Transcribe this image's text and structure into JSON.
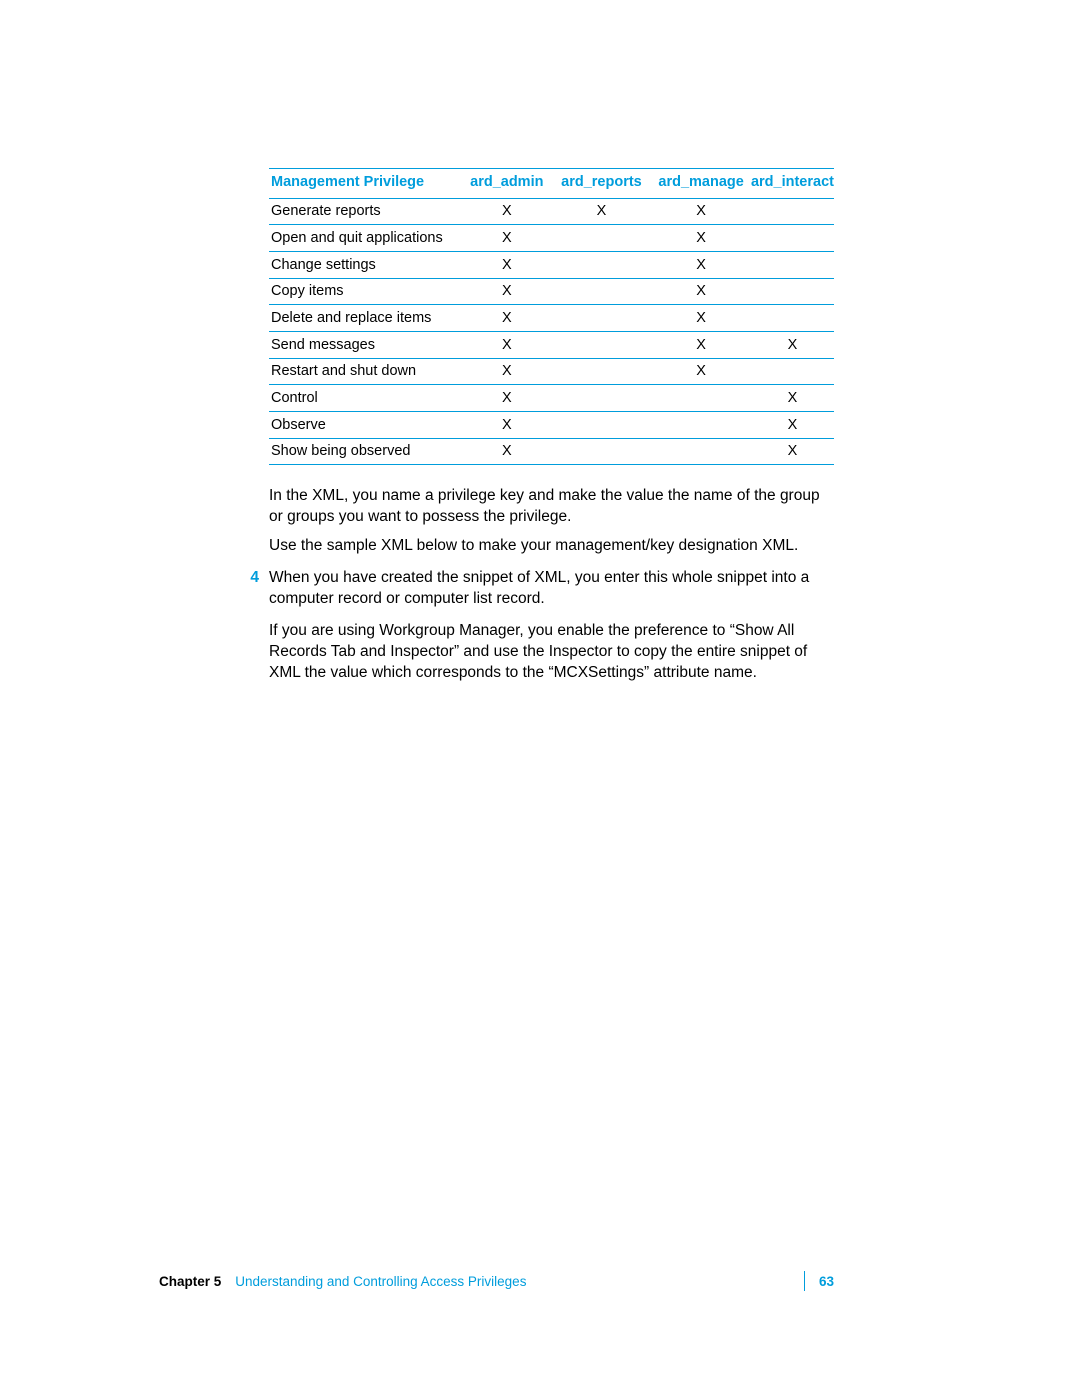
{
  "table": {
    "headers": [
      "Management Privilege",
      "ard_admin",
      "ard_reports",
      "ard_manage",
      "ard_interact"
    ],
    "rows": [
      {
        "name": "Generate reports",
        "cols": [
          "X",
          "X",
          "X",
          ""
        ]
      },
      {
        "name": "Open and quit applications",
        "cols": [
          "X",
          "",
          "X",
          ""
        ]
      },
      {
        "name": "Change settings",
        "cols": [
          "X",
          "",
          "X",
          ""
        ]
      },
      {
        "name": "Copy items",
        "cols": [
          "X",
          "",
          "X",
          ""
        ]
      },
      {
        "name": "Delete and replace items",
        "cols": [
          "X",
          "",
          "X",
          ""
        ]
      },
      {
        "name": "Send messages",
        "cols": [
          "X",
          "",
          "X",
          "X"
        ]
      },
      {
        "name": "Restart and shut down",
        "cols": [
          "X",
          "",
          "X",
          ""
        ]
      },
      {
        "name": "Control",
        "cols": [
          "X",
          "",
          "",
          "X"
        ]
      },
      {
        "name": "Observe",
        "cols": [
          "X",
          "",
          "",
          "X"
        ]
      },
      {
        "name": "Show being observed",
        "cols": [
          "X",
          "",
          "",
          "X"
        ]
      }
    ]
  },
  "paragraphs": {
    "p1": "In the XML, you name a privilege key and make the value the name of the group or groups you want to possess the privilege.",
    "p2": "Use the sample XML below to make your management/key designation XML.",
    "step4_num": "4",
    "step4_a": "When you have created the snippet of XML, you enter this whole snippet into a computer record or computer list record.",
    "step4_b": "If you are using Workgroup Manager, you enable the preference to “Show All Records Tab and Inspector” and use the Inspector to copy the entire snippet of XML the value which corresponds to the “MCXSettings” attribute name."
  },
  "footer": {
    "chapter_label": "Chapter 5",
    "chapter_title": "Understanding and Controlling Access Privileges",
    "page": "63"
  }
}
